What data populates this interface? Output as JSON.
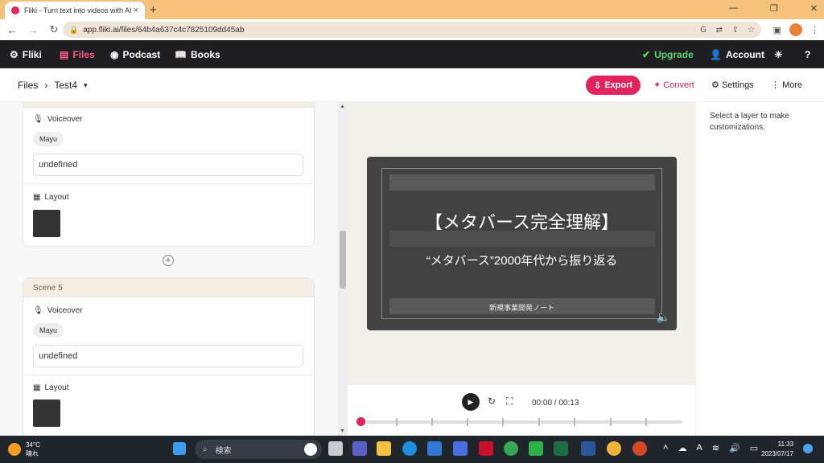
{
  "browser": {
    "tab_title": "Fliki - Turn text into videos with AI",
    "url": "app.fliki.ai/files/64b4a637c4c7825109dd45ab",
    "new_tab": "+",
    "tab_close": "×"
  },
  "appnav": {
    "brand": "Fliki",
    "files": "Files",
    "podcast": "Podcast",
    "books": "Books",
    "upgrade": "Upgrade",
    "account": "Account"
  },
  "breadcrumb": {
    "root": "Files",
    "current": "Test4",
    "export": "Export",
    "convert": "Convert",
    "settings": "Settings",
    "more": "More"
  },
  "scenes": [
    {
      "voiceover_label": "Voiceover",
      "voice": "Mayu",
      "text": "undefined",
      "layout_label": "Layout"
    },
    {
      "header": "Scene 5",
      "voiceover_label": "Voiceover",
      "voice": "Mayu",
      "text": "undefined",
      "layout_label": "Layout"
    }
  ],
  "preview": {
    "title": "【メタバース完全理解】",
    "subtitle": "“メタバース”2000年代から振り返る",
    "footer": "新規事業開発ノート",
    "timecode": "00:00 / 00:13",
    "progress": 0
  },
  "right_panel": {
    "hint": "Select a layer to make customizations."
  },
  "taskbar": {
    "temp": "34°C",
    "weather": "晴れ",
    "search": "検索",
    "time": "11:33",
    "date": "2023/07/17",
    "ime": "A"
  },
  "colors": {
    "accent": "#e0245e",
    "upgrade": "#5ed36f",
    "nav_bg": "#1f1f21"
  }
}
